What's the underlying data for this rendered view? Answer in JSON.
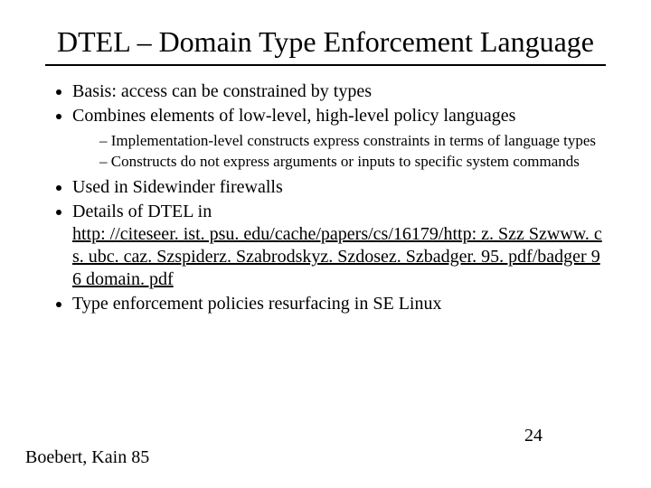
{
  "title": "DTEL – Domain Type Enforcement Language",
  "bullets": {
    "b1": "Basis: access can be constrained by types",
    "b2": "Combines elements of low-level, high-level policy languages",
    "b2_sub1": "Implementation-level constructs express constraints in terms of language types",
    "b2_sub2": "Constructs do not express arguments or inputs to specific system commands",
    "b3": "Used in Sidewinder firewalls",
    "b4_prefix": "Details of DTEL in",
    "b4_link": "http: //citeseer. ist. psu. edu/cache/papers/cs/16179/http: z. Szz Szwww. cs. ubc. caz. Szspiderz. Szabrodskyz. Szdosez. Szbadger. 95. pdf/badger 96 domain. pdf",
    "b5": "Type enforcement policies resurfacing in SE Linux"
  },
  "footer": "Boebert, Kain 85",
  "page_number": "24"
}
